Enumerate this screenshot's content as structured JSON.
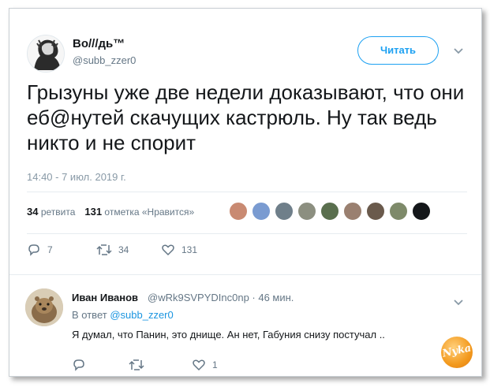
{
  "tweet": {
    "author_name": "Во///дь™",
    "author_handle": "@subb_zzer0",
    "follow_label": "Читать",
    "text": "Грызуны уже две недели доказывают, что они еб@нутей скачущих кастрюль. Ну так ведь никто и не спорит",
    "timestamp": "14:40 - 7 июл. 2019 г.",
    "retweets_count": "34",
    "retweets_label": "ретвита",
    "likes_count": "131",
    "likes_label": "отметка «Нравится»",
    "likers": [
      "#c98a72",
      "#7a9bd1",
      "#6f7f8a",
      "#8c8f80",
      "#5a6f4e",
      "#9a8070",
      "#6a5a4c",
      "#7e8a6a",
      "#4f5358"
    ],
    "actions": {
      "reply": "7",
      "retweet": "34",
      "like": "131"
    }
  },
  "reply": {
    "author_name": "Иван Иванов",
    "author_handle": "@wRk9SVPYDInc0np · 46 мин.",
    "in_reply_prefix": "В ответ",
    "in_reply_handle": "@subb_zzer0",
    "text": "Я думал, что Панин, это днище. Ан нет, Габуния снизу постучал ..",
    "actions": {
      "reply": "",
      "retweet": "",
      "like": "1"
    }
  },
  "watermark": {
    "text": "Nyka"
  },
  "colors": {
    "accent": "#1da1f2",
    "muted": "#657786",
    "link": "#1b95e0"
  }
}
